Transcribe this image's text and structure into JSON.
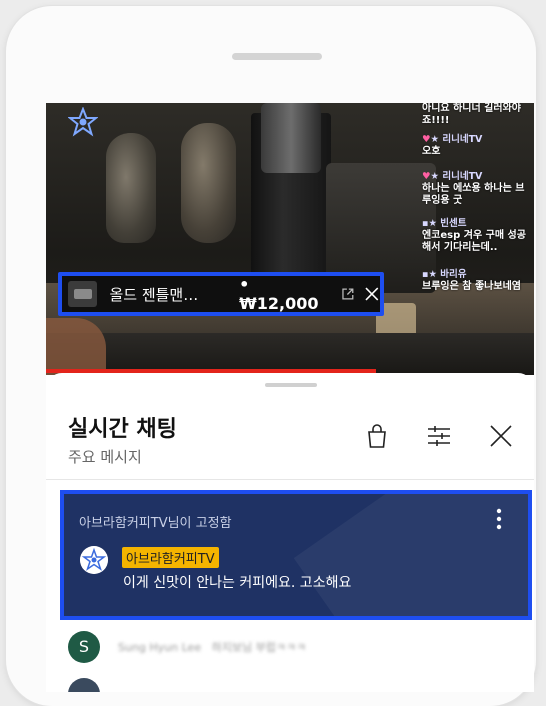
{
  "video": {
    "overlay_chat": [
      {
        "user": "",
        "text": "아니요 하니너 길러와야"
      },
      {
        "user": "",
        "text": "죠!!!!"
      },
      {
        "user": "리니네TV",
        "text": "오호"
      },
      {
        "user": "리니네TV",
        "text": "하나는 에쏘용 하나는 브"
      },
      {
        "user": "",
        "text": "루잉용 굿"
      },
      {
        "user": "빈센트",
        "text": "엔코esp 겨우 구매 성공"
      },
      {
        "user": "",
        "text": "해서 기다리는데.."
      },
      {
        "user": "바리유",
        "text": "브루잉은 참 좋나보네염"
      }
    ],
    "progress_fraction": 0.676
  },
  "product_pill": {
    "name": "올드 젠틀맨…",
    "price": "• ₩12,000"
  },
  "chat_panel": {
    "title": "실시간 채팅",
    "subtitle": "주요 메시지",
    "pinned": {
      "header": "아브라함커피TV님이 고정함",
      "author": "아브라함커피TV",
      "message": "이게 신맛이 안나는 커피에요. 고소해요",
      "background": "#1f3264"
    },
    "messages": [
      {
        "initial": "S",
        "author": "Sung Hyun Lee",
        "text": "하지보님 부럽ㅋㅋㅋ"
      }
    ]
  },
  "colors": {
    "highlight_border": "#1e4ef0",
    "author_badge": "#f4b400",
    "progress": "#e3241b",
    "avatar_s": "#1f5a45"
  },
  "icons": [
    "channel-logo-icon",
    "external-link-icon",
    "close-icon",
    "shopping-bag-icon",
    "tune-icon",
    "more-vert-icon"
  ]
}
